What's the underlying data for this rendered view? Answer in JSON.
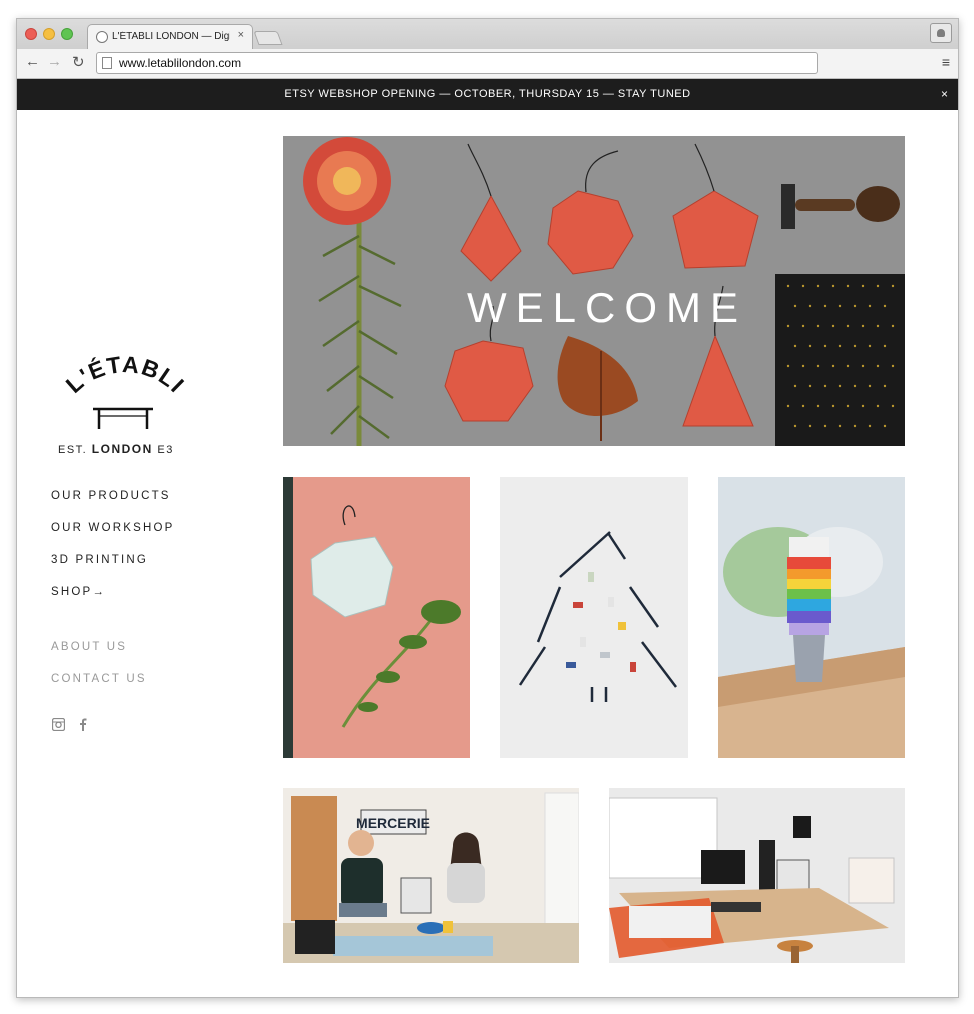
{
  "browser": {
    "tab_title": "L'ÉTABLI LONDON — Digital",
    "tab_close": "×",
    "url": "www.letablilondon.com",
    "menu_icon": "≡"
  },
  "banner": {
    "text": "ETSY WEBSHOP OPENING — OCTOBER, THURSDAY 15 — STAY TUNED",
    "close": "×"
  },
  "logo": {
    "arc_text": "L'ÉTABLI",
    "est": "EST.",
    "city": "LONDON",
    "postcode": "E3"
  },
  "nav": {
    "primary": [
      "OUR PRODUCTS",
      "OUR WORKSHOP",
      "3D PRINTING",
      "SHOP→"
    ],
    "secondary": [
      "ABOUT US",
      "CONTACT US"
    ],
    "social": [
      "instagram-icon",
      "facebook-icon"
    ]
  },
  "hero": {
    "title": "WELCOME"
  },
  "photos": {
    "mercerie_sign": "MERCERIE"
  },
  "colors": {
    "banner_bg": "#1d1d1d",
    "ornament": "#e05a45",
    "hero_bg": "#8f8f8f",
    "pink_bg": "#e59a8b"
  }
}
